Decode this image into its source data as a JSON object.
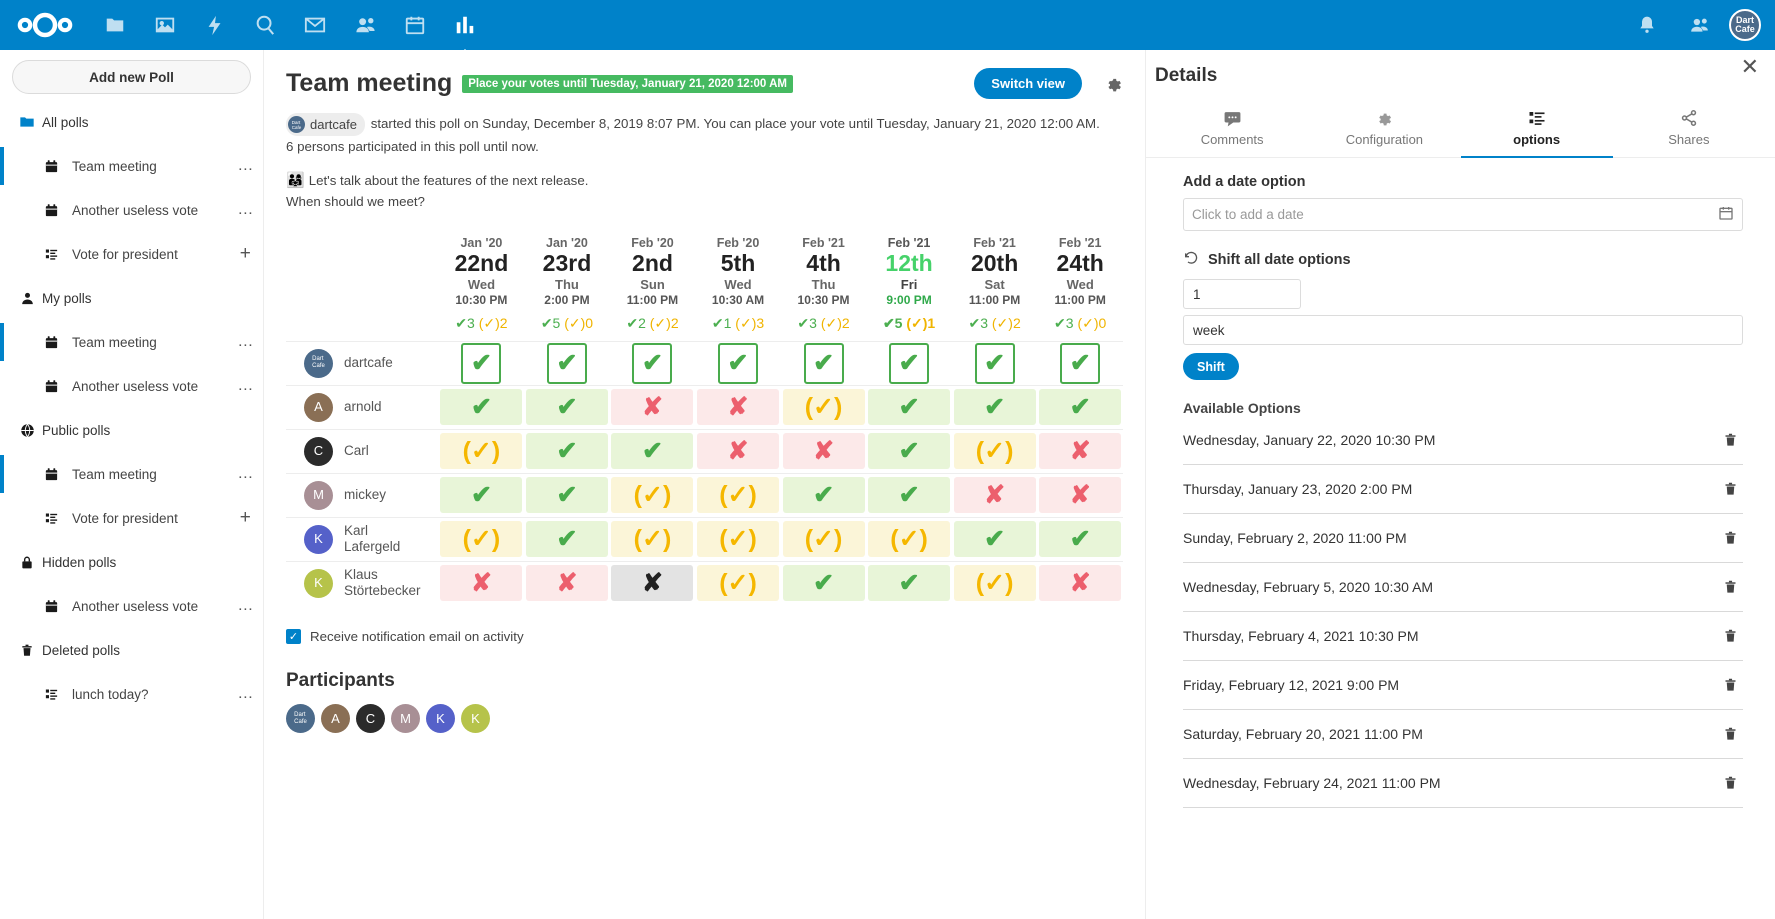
{
  "topbar": {
    "logo_name": "nextcloud-logo",
    "apps": [
      {
        "name": "files-icon",
        "label": "Files"
      },
      {
        "name": "photos-icon",
        "label": "Photos"
      },
      {
        "name": "activity-icon",
        "label": "Activity"
      },
      {
        "name": "search-icon",
        "label": "Search"
      },
      {
        "name": "mail-icon",
        "label": "Mail"
      },
      {
        "name": "contacts-icon",
        "label": "Contacts"
      },
      {
        "name": "calendar-icon",
        "label": "Calendar"
      },
      {
        "name": "polls-icon",
        "label": "Polls",
        "active": true
      }
    ],
    "right": [
      {
        "name": "notifications-bell-icon"
      },
      {
        "name": "contacts-menu-icon"
      }
    ],
    "user_avatar_text": "Dart Cafe",
    "accent_color": "#0082c9"
  },
  "sidebar": {
    "add_poll_label": "Add new Poll",
    "groups": [
      {
        "label": "All polls",
        "icon": "folder-icon",
        "items": [
          {
            "label": "Team meeting",
            "icon": "calendar-icon",
            "trail": "…",
            "selected": true
          },
          {
            "label": "Another useless vote",
            "icon": "calendar-icon",
            "trail": "…",
            "selected": false
          },
          {
            "label": "Vote for president",
            "icon": "list-icon",
            "trail": "+",
            "selected": false
          }
        ]
      },
      {
        "label": "My polls",
        "icon": "user-icon",
        "items": [
          {
            "label": "Team meeting",
            "icon": "calendar-icon",
            "trail": "…",
            "selected": true
          },
          {
            "label": "Another useless vote",
            "icon": "calendar-icon",
            "trail": "…",
            "selected": false
          }
        ]
      },
      {
        "label": "Public polls",
        "icon": "globe-icon",
        "items": [
          {
            "label": "Team meeting",
            "icon": "calendar-icon",
            "trail": "…",
            "selected": true
          },
          {
            "label": "Vote for president",
            "icon": "list-icon",
            "trail": "+",
            "selected": false
          }
        ]
      },
      {
        "label": "Hidden polls",
        "icon": "lock-icon",
        "items": [
          {
            "label": "Another useless vote",
            "icon": "calendar-icon",
            "trail": "…",
            "selected": false
          }
        ]
      },
      {
        "label": "Deleted polls",
        "icon": "trash-icon",
        "items": [
          {
            "label": "lunch today?",
            "icon": "list-icon",
            "trail": "…",
            "selected": false
          }
        ]
      }
    ]
  },
  "main": {
    "poll_title": "Team meeting",
    "expiry_badge": "Place your votes until Tuesday, January 21, 2020 12:00 AM",
    "switch_view_label": "Switch view",
    "owner_name": "dartcafe",
    "description_text": "started this poll on Sunday, December 8, 2019 8:07 PM. You can place your vote until Tuesday, January 21, 2020 12:00 AM. 6 persons participated in this poll until now.",
    "note_emoji": "👨‍👩‍👧",
    "note_line1": "Let's talk about the features of the next release.",
    "note_line2": "When should we meet?",
    "notification_label": "Receive notification email on activity",
    "notification_checked": true,
    "participants_heading": "Participants",
    "participants": [
      {
        "name": "dartcafe",
        "initial": "D",
        "color": "#4b6a8a"
      },
      {
        "name": "arnold",
        "initial": "A",
        "color": "#8a6f55"
      },
      {
        "name": "Carl",
        "initial": "C",
        "color": "#2b2b2b"
      },
      {
        "name": "mickey",
        "initial": "M",
        "color": "#a88f95"
      },
      {
        "name": "Karl Lafergeld",
        "initial": "K",
        "color": "#5561c9"
      },
      {
        "name": "Klaus Störtebecker",
        "initial": "K",
        "color": "#b6c34a"
      }
    ]
  },
  "vote_table": {
    "options": [
      {
        "month": "Jan '20",
        "day": "22nd",
        "dow": "Wed",
        "time": "10:30 PM",
        "yes": "3",
        "maybe": "2",
        "highlight": false
      },
      {
        "month": "Jan '20",
        "day": "23rd",
        "dow": "Thu",
        "time": "2:00 PM",
        "yes": "5",
        "maybe": "0",
        "highlight": false
      },
      {
        "month": "Feb '20",
        "day": "2nd",
        "dow": "Sun",
        "time": "11:00 PM",
        "yes": "2",
        "maybe": "2",
        "highlight": false
      },
      {
        "month": "Feb '20",
        "day": "5th",
        "dow": "Wed",
        "time": "10:30 AM",
        "yes": "1",
        "maybe": "3",
        "highlight": false
      },
      {
        "month": "Feb '21",
        "day": "4th",
        "dow": "Thu",
        "time": "10:30 PM",
        "yes": "3",
        "maybe": "2",
        "highlight": false
      },
      {
        "month": "Feb '21",
        "day": "12th",
        "dow": "Fri",
        "time": "9:00 PM",
        "yes": "5",
        "maybe": "1",
        "highlight": true
      },
      {
        "month": "Feb '21",
        "day": "20th",
        "dow": "Sat",
        "time": "11:00 PM",
        "yes": "3",
        "maybe": "2",
        "highlight": false
      },
      {
        "month": "Feb '21",
        "day": "24th",
        "dow": "Wed",
        "time": "11:00 PM",
        "yes": "3",
        "maybe": "0",
        "highlight": false
      }
    ],
    "rows": [
      {
        "user": "dartcafe",
        "initial": "D",
        "color": "#4b6a8a",
        "own": true,
        "votes": [
          "yes",
          "yes",
          "yes",
          "yes",
          "yes",
          "yes",
          "yes",
          "yes"
        ]
      },
      {
        "user": "arnold",
        "initial": "A",
        "color": "#8a6f55",
        "own": false,
        "votes": [
          "yes",
          "yes",
          "no",
          "no",
          "maybe",
          "yes",
          "yes",
          "yes"
        ]
      },
      {
        "user": "Carl",
        "initial": "C",
        "color": "#2b2b2b",
        "own": false,
        "votes": [
          "maybe",
          "yes",
          "yes",
          "no",
          "no",
          "yes",
          "maybe",
          "no"
        ]
      },
      {
        "user": "mickey",
        "initial": "M",
        "color": "#a88f95",
        "own": false,
        "votes": [
          "yes",
          "yes",
          "maybe",
          "maybe",
          "yes",
          "yes",
          "no",
          "no"
        ]
      },
      {
        "user": "Karl Lafergeld",
        "initial": "K",
        "color": "#5561c9",
        "own": false,
        "votes": [
          "maybe",
          "yes",
          "maybe",
          "maybe",
          "maybe",
          "maybe",
          "yes",
          "yes"
        ]
      },
      {
        "user": "Klaus Störtebecker",
        "initial": "K",
        "color": "#b6c34a",
        "own": false,
        "votes": [
          "no",
          "no",
          "clicked",
          "maybe",
          "yes",
          "yes",
          "maybe",
          "no"
        ]
      }
    ]
  },
  "details": {
    "title": "Details",
    "tabs": [
      {
        "label": "Comments",
        "icon": "comment-icon",
        "active": false
      },
      {
        "label": "Configuration",
        "icon": "gear-icon",
        "active": false
      },
      {
        "label": "options",
        "icon": "list-options-icon",
        "active": true
      },
      {
        "label": "Shares",
        "icon": "share-icon",
        "active": false
      }
    ],
    "add_date_label": "Add a date option",
    "add_date_placeholder": "Click to add a date",
    "shift_heading": "Shift all date options",
    "shift_amount": "1",
    "shift_unit": "week",
    "shift_button": "Shift",
    "available_label": "Available Options",
    "options": [
      "Wednesday, January 22, 2020 10:30 PM",
      "Thursday, January 23, 2020 2:00 PM",
      "Sunday, February 2, 2020 11:00 PM",
      "Wednesday, February 5, 2020 10:30 AM",
      "Thursday, February 4, 2021 10:30 PM",
      "Friday, February 12, 2021 9:00 PM",
      "Saturday, February 20, 2021 11:00 PM",
      "Wednesday, February 24, 2021 11:00 PM"
    ]
  }
}
